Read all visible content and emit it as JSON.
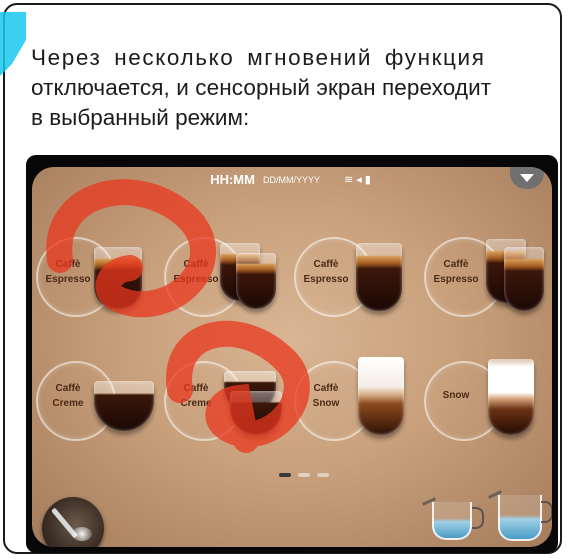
{
  "paragraph": {
    "line1": "Через несколько мгновений функция",
    "line2": "отключается, и сенсорный экран переходит",
    "line3": "в выбранный режим:"
  },
  "screen": {
    "time": "HH:MM",
    "date": "DD/MM/YYYY",
    "status_icons": "wifi-icon speaker-icon battery-icon",
    "row1": [
      {
        "line1": "Caffè",
        "line2": "Espresso"
      },
      {
        "line1": "Caffè",
        "line2": "Espresso"
      },
      {
        "line1": "Caffè",
        "line2": "Espresso"
      },
      {
        "line1": "Caffè",
        "line2": "Espresso"
      }
    ],
    "row2": [
      {
        "line1": "Caffè",
        "line2": "Creme"
      },
      {
        "line1": "Caffè",
        "line2": "Creme"
      },
      {
        "line1": "Caffè",
        "line2": "Snow"
      },
      {
        "line1": "Snow",
        "line2": ""
      }
    ],
    "page_count": 3,
    "active_page": 1
  },
  "colors": {
    "watermark": "#e8371d",
    "corner_accent": "#19c7ee",
    "screen_bg": "#c8a07c"
  }
}
